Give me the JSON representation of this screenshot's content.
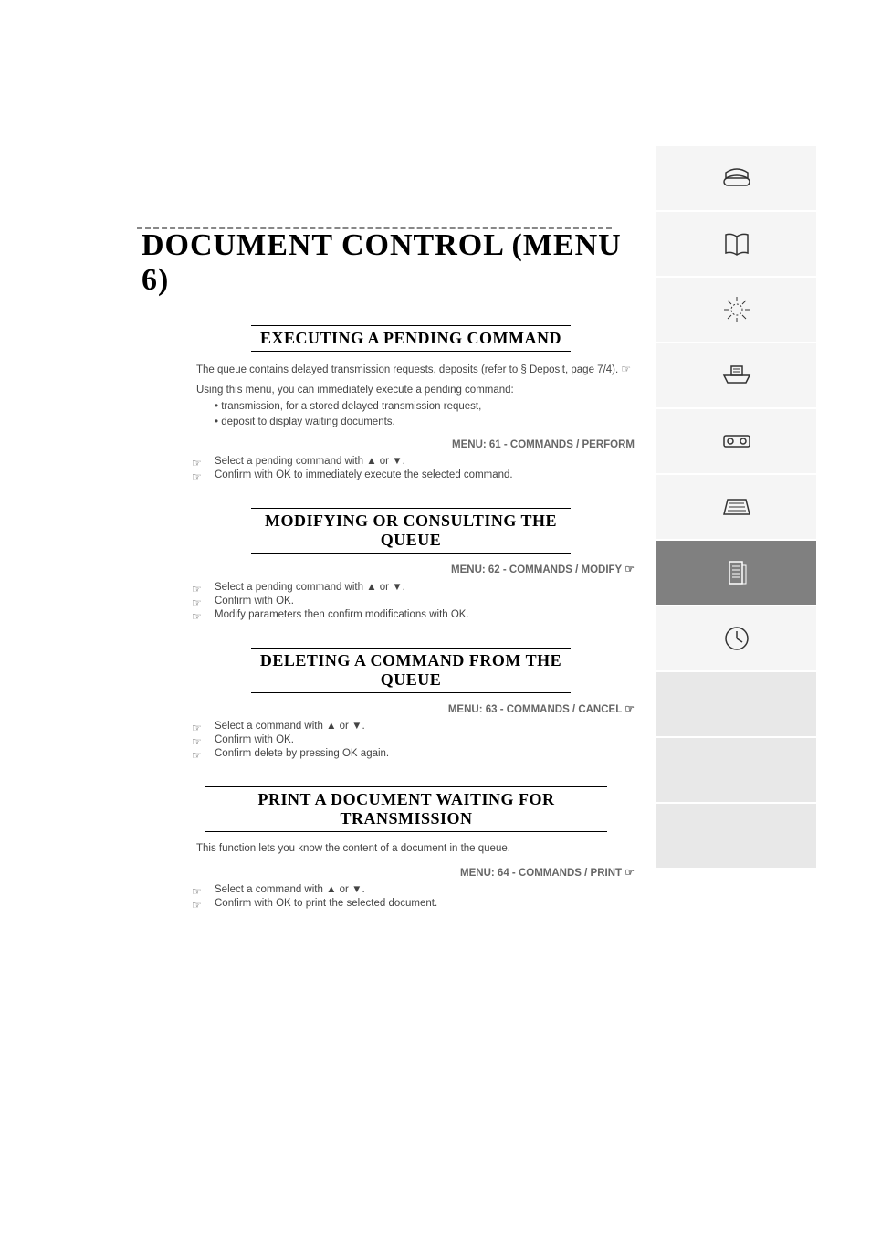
{
  "heading": "DOCUMENT CONTROL (MENU 6)",
  "sections": {
    "s1": {
      "title": "EXECUTING A PENDING COMMAND",
      "intro": "The queue contains delayed transmission requests, deposits (refer to § Deposit, page 7/4).",
      "para1": "Using this menu, you can immediately execute a pending command:",
      "item1": "transmission, for a stored delayed transmission request,",
      "item2": "deposit to display waiting documents.",
      "menu": "MENU: 61 - COMMANDS / PERFORM",
      "step1": "Select a pending command with ▲ or ▼.",
      "step2": "Confirm with OK to immediately execute the selected command."
    },
    "s2": {
      "title": "MODIFYING OR CONSULTING THE QUEUE",
      "menu": "MENU: 62 - COMMANDS / MODIFY",
      "step1": "Select a pending command with ▲ or ▼.",
      "step2": "Confirm with OK.",
      "step3": "Modify parameters then confirm modifications with OK."
    },
    "s3": {
      "title": "DELETING A COMMAND FROM THE QUEUE",
      "menu": "MENU: 63 - COMMANDS / CANCEL",
      "step1": "Select a command with ▲ or ▼.",
      "step2": "Confirm with OK.",
      "step3": "Confirm delete by pressing OK again."
    },
    "s4": {
      "title": "PRINT A DOCUMENT WAITING FOR TRANSMISSION",
      "intro": "This function lets you know the content of a document in the queue.",
      "menu": "MENU: 64 - COMMANDS / PRINT",
      "step1": "Select a command with ▲ or ▼.",
      "step2": "Confirm with OK to print the selected document."
    }
  },
  "sidebar": {
    "items": [
      {
        "name": "phone-icon",
        "active": false
      },
      {
        "name": "book-icon",
        "active": false
      },
      {
        "name": "sun-icon",
        "active": false
      },
      {
        "name": "printer-icon",
        "active": false
      },
      {
        "name": "tape-icon",
        "active": false
      },
      {
        "name": "scanner-icon",
        "active": false
      },
      {
        "name": "document-icon",
        "active": true
      },
      {
        "name": "clock-icon",
        "active": false
      },
      {
        "name": "empty",
        "active": false
      },
      {
        "name": "empty",
        "active": false
      },
      {
        "name": "empty",
        "active": false
      }
    ]
  },
  "footer": ""
}
